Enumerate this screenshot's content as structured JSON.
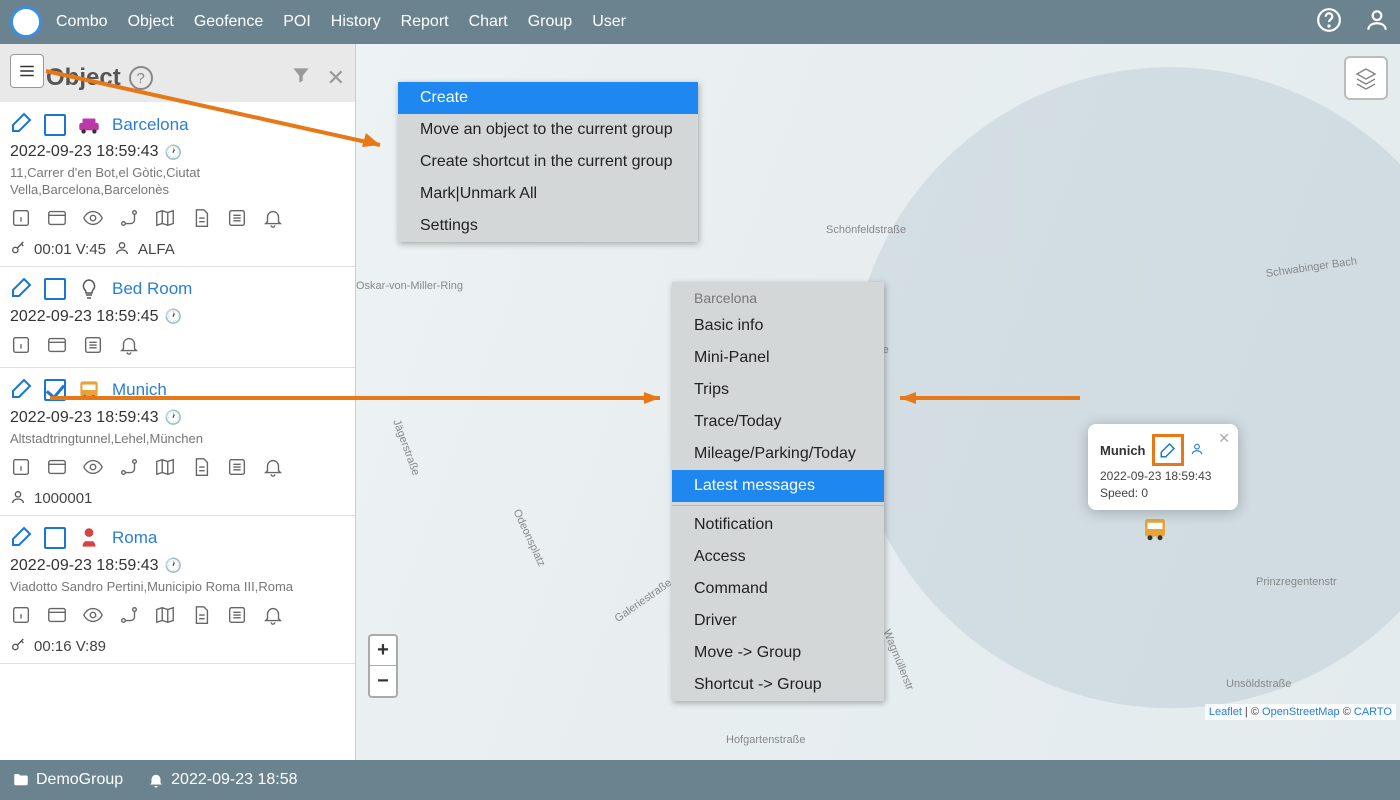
{
  "nav": {
    "items": [
      "Combo",
      "Object",
      "Geofence",
      "POI",
      "History",
      "Report",
      "Chart",
      "Group",
      "User"
    ]
  },
  "sidebar": {
    "title": "Object",
    "objects": [
      {
        "name": "Barcelona",
        "ts": "2022-09-23 18:59:43",
        "addr": "11,Carrer d'en Bot,el Gòtic,Ciutat Vella,Barcelona,Barcelonès",
        "extra_key": "00:01 V:45",
        "extra_user": "ALFA",
        "icon": "car",
        "checked": false
      },
      {
        "name": "Bed Room",
        "ts": "2022-09-23 18:59:45",
        "addr": "",
        "icon": "bulb",
        "checked": false
      },
      {
        "name": "Munich",
        "ts": "2022-09-23 18:59:43",
        "addr": "Altstadtringtunnel,Lehel,München",
        "extra_user": "1000001",
        "icon": "bus",
        "checked": true
      },
      {
        "name": "Roma",
        "ts": "2022-09-23 18:59:43",
        "addr": "Viadotto Sandro Pertini,Municipio Roma III,Roma",
        "extra_key": "00:16 V:89",
        "icon": "person",
        "checked": false
      }
    ]
  },
  "context_menu_1": {
    "items": [
      "Create",
      "Move an object to the current group",
      "Create shortcut in the current group",
      "Mark|Unmark All",
      "Settings"
    ],
    "selected_index": 0
  },
  "context_menu_2": {
    "heading": "Barcelona",
    "group1": [
      "Basic info",
      "Mini-Panel",
      "Trips",
      "Trace/Today",
      "Mileage/Parking/Today",
      "Latest messages"
    ],
    "group1_selected_index": 5,
    "group2": [
      "Notification",
      "Access",
      "Command",
      "Driver",
      "Move -> Group",
      "Shortcut -> Group"
    ]
  },
  "popup": {
    "title": "Munich",
    "ts": "2022-09-23 18:59:43",
    "speed": "Speed: 0"
  },
  "footer": {
    "group": "DemoGroup",
    "time": "2022-09-23 18:58"
  },
  "zoom": {
    "in": "+",
    "out": "−"
  },
  "attrib": {
    "leaflet": "Leaflet",
    "sep1": " | © ",
    "osm": "OpenStreetMap",
    "sep2": " © ",
    "carto": "CARTO"
  },
  "streets": {
    "s1": "Altstadtringtunnel",
    "s2": "Schönfeldstraße",
    "s3": "Prinzregentenstr",
    "s4": "Von-der-Tann-Straße",
    "s5": "Unsöldstraße",
    "s6": "Schwabinger Bach",
    "s7": "Hofgartenstraße",
    "s8": "Jägerstraße",
    "s9": "Odeonsplatz",
    "s10": "Galeriestraße",
    "s11": "Oskar-von-Miller-Ring",
    "s12": "Wagmüllerstr"
  }
}
